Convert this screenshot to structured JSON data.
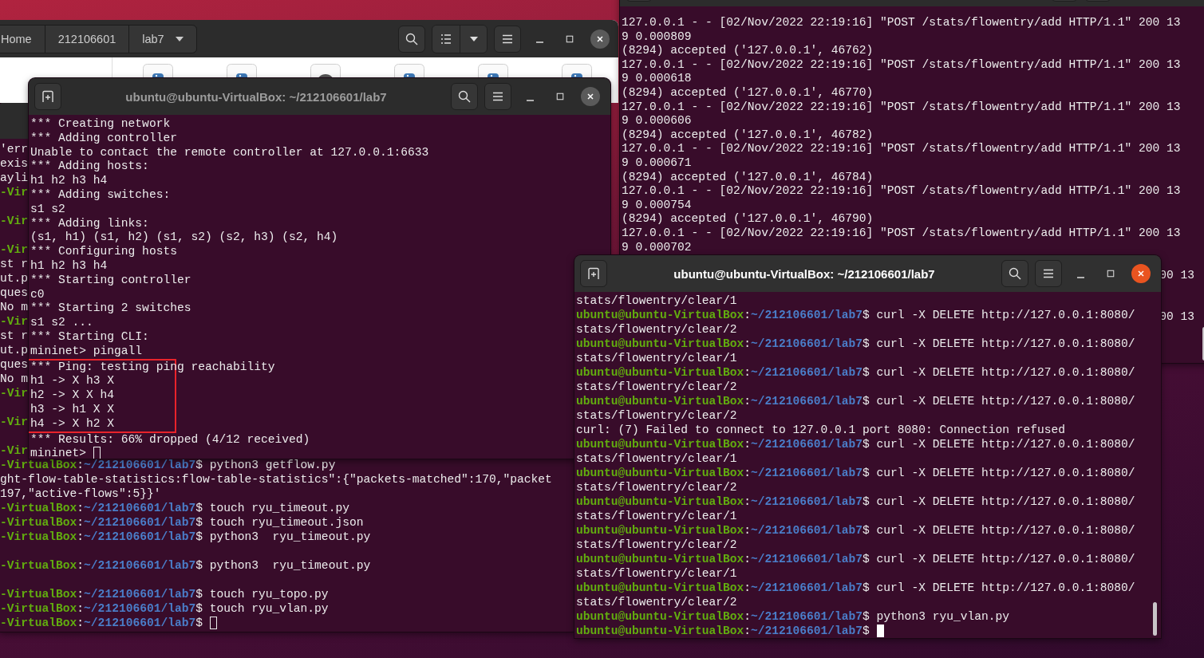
{
  "file_manager": {
    "path": [
      {
        "label": "Home"
      },
      {
        "label": "212106601"
      },
      {
        "label": "lab7"
      }
    ],
    "files": [
      {
        "kind": "python"
      },
      {
        "kind": "python"
      },
      {
        "kind": "generic"
      },
      {
        "kind": "python"
      },
      {
        "kind": "python"
      },
      {
        "kind": "python"
      }
    ]
  },
  "terminals": [
    {
      "kind": "bare",
      "focused": false,
      "lines": [
        {
          "kind": "output",
          "text": "'err"
        },
        {
          "kind": "output",
          "text": "exis"
        },
        {
          "kind": "output",
          "text": "ayli"
        },
        {
          "kind": "prompt",
          "host": "-Vir"
        },
        {
          "kind": "blank"
        },
        {
          "kind": "prompt",
          "host": "-Vir"
        },
        {
          "kind": "blank"
        },
        {
          "kind": "prompt",
          "host": "-Vir"
        },
        {
          "kind": "output",
          "text": "st r"
        },
        {
          "kind": "output",
          "text": "ut.p"
        },
        {
          "kind": "output",
          "text": "ques"
        },
        {
          "kind": "output",
          "text": "No m"
        },
        {
          "kind": "prompt",
          "host": "-Vir"
        },
        {
          "kind": "output",
          "text": "st r"
        },
        {
          "kind": "output",
          "text": "ut.p"
        },
        {
          "kind": "output",
          "text": "ques"
        },
        {
          "kind": "output",
          "text": "No m"
        },
        {
          "kind": "prompt",
          "host": "-Vir"
        },
        {
          "kind": "blank"
        },
        {
          "kind": "prompt",
          "host": "-Vir"
        },
        {
          "kind": "blank"
        },
        {
          "kind": "prompt",
          "host": "-Vir"
        },
        {
          "kind": "prompt",
          "host": "-VirtualBox",
          "sep": ":",
          "path": "~/212106601/lab7",
          "command": "$ python3 getflow.py"
        },
        {
          "kind": "output",
          "text": "ght-flow-table-statistics:flow-table-statistics\":{\"packets-matched\":170,\"packet"
        },
        {
          "kind": "output",
          "text": "197,\"active-flows\":5}}'"
        },
        {
          "kind": "prompt",
          "host": "-VirtualBox",
          "sep": ":",
          "path": "~/212106601/lab7",
          "command": "$ touch ryu_timeout.py"
        },
        {
          "kind": "prompt",
          "host": "-VirtualBox",
          "sep": ":",
          "path": "~/212106601/lab7",
          "command": "$ touch ryu_timeout.json"
        },
        {
          "kind": "prompt",
          "host": "-VirtualBox",
          "sep": ":",
          "path": "~/212106601/lab7",
          "command": "$ python3  ryu_timeout.py"
        },
        {
          "kind": "blank"
        },
        {
          "kind": "prompt",
          "host": "-VirtualBox",
          "sep": ":",
          "path": "~/212106601/lab7",
          "command": "$ python3  ryu_timeout.py"
        },
        {
          "kind": "blank"
        },
        {
          "kind": "prompt",
          "host": "-VirtualBox",
          "sep": ":",
          "path": "~/212106601/lab7",
          "command": "$ touch ryu_topo.py"
        },
        {
          "kind": "prompt",
          "host": "-VirtualBox",
          "sep": ":",
          "path": "~/212106601/lab7",
          "command": "$ touch ryu_vlan.py"
        },
        {
          "kind": "prompt",
          "host": "-VirtualBox",
          "sep": ":",
          "path": "~/212106601/lab7",
          "command": "$",
          "cursor": true
        }
      ]
    },
    {
      "kind": "full",
      "title": "ubuntu@ubuntu-VirtualBox: ~/212106601/lab7",
      "focused": false,
      "lines": [
        {
          "kind": "output",
          "text": "*** Creating network"
        },
        {
          "kind": "output",
          "text": "*** Adding controller"
        },
        {
          "kind": "output",
          "text": "Unable to contact the remote controller at 127.0.0.1:6633"
        },
        {
          "kind": "output",
          "text": "*** Adding hosts:"
        },
        {
          "kind": "output",
          "text": "h1 h2 h3 h4"
        },
        {
          "kind": "output",
          "text": "*** Adding switches:"
        },
        {
          "kind": "output",
          "text": "s1 s2"
        },
        {
          "kind": "output",
          "text": "*** Adding links:"
        },
        {
          "kind": "output",
          "text": "(s1, h1) (s1, h2) (s1, s2) (s2, h3) (s2, h4)"
        },
        {
          "kind": "output",
          "text": "*** Configuring hosts"
        },
        {
          "kind": "output",
          "text": "h1 h2 h3 h4"
        },
        {
          "kind": "output",
          "text": "*** Starting controller"
        },
        {
          "kind": "output",
          "text": "c0"
        },
        {
          "kind": "output",
          "text": "*** Starting 2 switches"
        },
        {
          "kind": "output",
          "text": "s1 s2 ..."
        },
        {
          "kind": "output",
          "text": "*** Starting CLI:"
        },
        {
          "kind": "output",
          "text": "mininet> pingall"
        },
        {
          "kind": "output",
          "text": "*** Ping: testing ping reachability",
          "highlighted": true
        },
        {
          "kind": "output",
          "text": "h1 -> X h3 X",
          "highlighted": true
        },
        {
          "kind": "output",
          "text": "h2 -> X X h4",
          "highlighted": true
        },
        {
          "kind": "output",
          "text": "h3 -> h1 X X",
          "highlighted": true
        },
        {
          "kind": "output",
          "text": "h4 -> X h2 X",
          "highlighted": true
        },
        {
          "kind": "output",
          "text": "*** Results: 66% dropped (4/12 received)"
        },
        {
          "kind": "output",
          "text": "mininet>",
          "cursor": true
        }
      ]
    },
    {
      "kind": "full",
      "lines": [
        {
          "kind": "output",
          "text": "127.0.0.1 - - [02/Nov/2022 22:19:16] \"POST /stats/flowentry/add HTTP/1.1\" 200 13"
        },
        {
          "kind": "output",
          "text": "9 0.000809"
        },
        {
          "kind": "output",
          "text": "(8294) accepted ('127.0.0.1', 46762)"
        },
        {
          "kind": "output",
          "text": "127.0.0.1 - - [02/Nov/2022 22:19:16] \"POST /stats/flowentry/add HTTP/1.1\" 200 13"
        },
        {
          "kind": "output",
          "text": "9 0.000618"
        },
        {
          "kind": "output",
          "text": "(8294) accepted ('127.0.0.1', 46770)"
        },
        {
          "kind": "output",
          "text": "127.0.0.1 - - [02/Nov/2022 22:19:16] \"POST /stats/flowentry/add HTTP/1.1\" 200 13"
        },
        {
          "kind": "output",
          "text": "9 0.000606"
        },
        {
          "kind": "output",
          "text": "(8294) accepted ('127.0.0.1', 46782)"
        },
        {
          "kind": "output",
          "text": "127.0.0.1 - - [02/Nov/2022 22:19:16] \"POST /stats/flowentry/add HTTP/1.1\" 200 13"
        },
        {
          "kind": "output",
          "text": "9 0.000671"
        },
        {
          "kind": "output",
          "text": "(8294) accepted ('127.0.0.1', 46784)"
        },
        {
          "kind": "output",
          "text": "127.0.0.1 - - [02/Nov/2022 22:19:16] \"POST /stats/flowentry/add HTTP/1.1\" 200 13"
        },
        {
          "kind": "output",
          "text": "9 0.000754"
        },
        {
          "kind": "output",
          "text": "(8294) accepted ('127.0.0.1', 46790)"
        },
        {
          "kind": "output",
          "text": "127.0.0.1 - - [02/Nov/2022 22:19:16] \"POST /stats/flowentry/add HTTP/1.1\" 200 13"
        },
        {
          "kind": "output",
          "text": "9 0.000702"
        },
        {
          "kind": "blank"
        },
        {
          "kind": "tail",
          "text": "00 13"
        },
        {
          "kind": "blank"
        },
        {
          "kind": "blank"
        },
        {
          "kind": "tail",
          "text": "00 13"
        }
      ]
    },
    {
      "kind": "full",
      "title": "ubuntu@ubuntu-VirtualBox: ~/212106601/lab7",
      "focused": true,
      "lines": [
        {
          "kind": "output",
          "text": "stats/flowentry/clear/1"
        },
        {
          "kind": "prompt",
          "host": "ubuntu@ubuntu-VirtualBox",
          "sep": ":",
          "path": "~/212106601/lab7",
          "command": "$ curl -X DELETE http://127.0.0.1:8080/"
        },
        {
          "kind": "output",
          "text": "stats/flowentry/clear/2"
        },
        {
          "kind": "prompt",
          "host": "ubuntu@ubuntu-VirtualBox",
          "sep": ":",
          "path": "~/212106601/lab7",
          "command": "$ curl -X DELETE http://127.0.0.1:8080/"
        },
        {
          "kind": "output",
          "text": "stats/flowentry/clear/1"
        },
        {
          "kind": "prompt",
          "host": "ubuntu@ubuntu-VirtualBox",
          "sep": ":",
          "path": "~/212106601/lab7",
          "command": "$ curl -X DELETE http://127.0.0.1:8080/"
        },
        {
          "kind": "output",
          "text": "stats/flowentry/clear/2"
        },
        {
          "kind": "prompt",
          "host": "ubuntu@ubuntu-VirtualBox",
          "sep": ":",
          "path": "~/212106601/lab7",
          "command": "$ curl -X DELETE http://127.0.0.1:8080/"
        },
        {
          "kind": "output",
          "text": "stats/flowentry/clear/2"
        },
        {
          "kind": "output",
          "text": "curl: (7) Failed to connect to 127.0.0.1 port 8080: Connection refused"
        },
        {
          "kind": "prompt",
          "host": "ubuntu@ubuntu-VirtualBox",
          "sep": ":",
          "path": "~/212106601/lab7",
          "command": "$ curl -X DELETE http://127.0.0.1:8080/"
        },
        {
          "kind": "output",
          "text": "stats/flowentry/clear/1"
        },
        {
          "kind": "prompt",
          "host": "ubuntu@ubuntu-VirtualBox",
          "sep": ":",
          "path": "~/212106601/lab7",
          "command": "$ curl -X DELETE http://127.0.0.1:8080/"
        },
        {
          "kind": "output",
          "text": "stats/flowentry/clear/2"
        },
        {
          "kind": "prompt",
          "host": "ubuntu@ubuntu-VirtualBox",
          "sep": ":",
          "path": "~/212106601/lab7",
          "command": "$ curl -X DELETE http://127.0.0.1:8080/"
        },
        {
          "kind": "output",
          "text": "stats/flowentry/clear/1"
        },
        {
          "kind": "prompt",
          "host": "ubuntu@ubuntu-VirtualBox",
          "sep": ":",
          "path": "~/212106601/lab7",
          "command": "$ curl -X DELETE http://127.0.0.1:8080/"
        },
        {
          "kind": "output",
          "text": "stats/flowentry/clear/2"
        },
        {
          "kind": "prompt",
          "host": "ubuntu@ubuntu-VirtualBox",
          "sep": ":",
          "path": "~/212106601/lab7",
          "command": "$ curl -X DELETE http://127.0.0.1:8080/"
        },
        {
          "kind": "output",
          "text": "stats/flowentry/clear/1"
        },
        {
          "kind": "prompt",
          "host": "ubuntu@ubuntu-VirtualBox",
          "sep": ":",
          "path": "~/212106601/lab7",
          "command": "$ curl -X DELETE http://127.0.0.1:8080/"
        },
        {
          "kind": "output",
          "text": "stats/flowentry/clear/2"
        },
        {
          "kind": "prompt",
          "host": "ubuntu@ubuntu-VirtualBox",
          "sep": ":",
          "path": "~/212106601/lab7",
          "command": "$ python3 ryu_vlan.py"
        },
        {
          "kind": "prompt",
          "host": "ubuntu@ubuntu-VirtualBox",
          "sep": ":",
          "path": "~/212106601/lab7",
          "command": "$",
          "cursor": true
        }
      ]
    }
  ]
}
